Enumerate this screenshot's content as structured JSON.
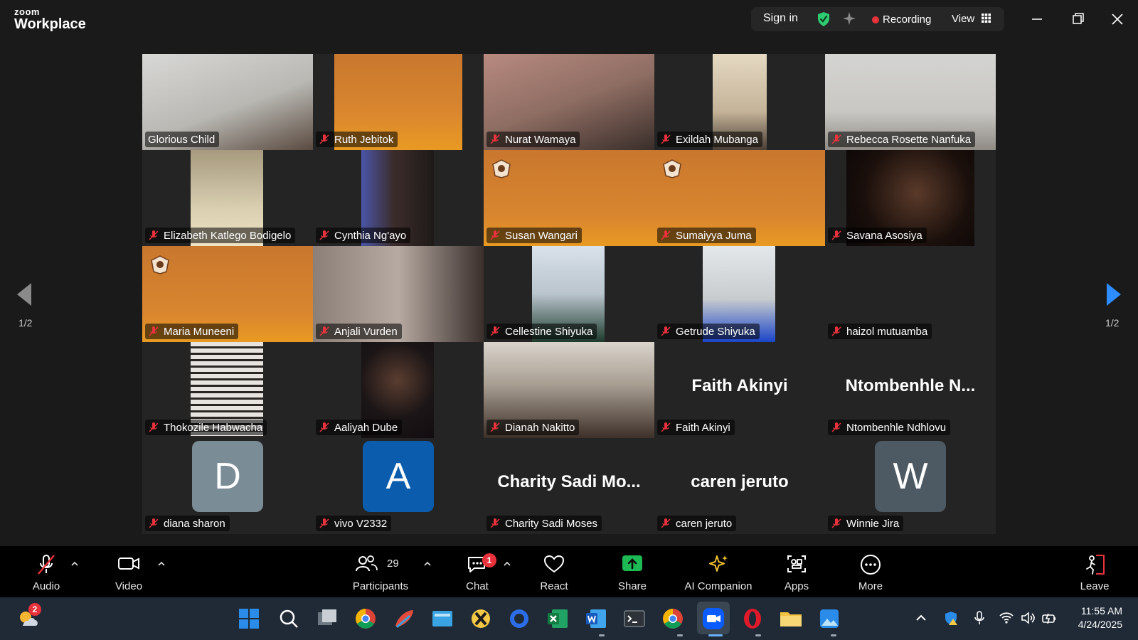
{
  "app": {
    "brand_small": "zoom",
    "brand_large": "Workplace"
  },
  "topbar": {
    "signin": "Sign in",
    "recording": "Recording",
    "view": "View"
  },
  "pagination": {
    "left": "1/2",
    "right": "1/2"
  },
  "tiles": [
    {
      "name": "Glorious Child",
      "muted": false,
      "active": true
    },
    {
      "name": "Ruth Jebitok",
      "muted": true
    },
    {
      "name": "Nurat Wamaya",
      "muted": true
    },
    {
      "name": "Exildah Mubanga",
      "muted": true
    },
    {
      "name": "Rebecca Rosette Nanfuka",
      "muted": true
    },
    {
      "name": "Elizabeth Katlego Bodigelo",
      "muted": true
    },
    {
      "name": "Cynthia Ng'ayo",
      "muted": true
    },
    {
      "name": "Susan Wangari",
      "muted": true
    },
    {
      "name": "Sumaiyya Juma",
      "muted": true
    },
    {
      "name": "Savana Asosiya",
      "muted": true
    },
    {
      "name": "Maria Muneeni",
      "muted": true
    },
    {
      "name": "Anjali Vurden",
      "muted": true
    },
    {
      "name": "Cellestine Shiyuka",
      "muted": true
    },
    {
      "name": "Getrude Shiyuka",
      "muted": true
    },
    {
      "name": "haizol mutuamba",
      "muted": true
    },
    {
      "name": "Thokozile Habwacha",
      "muted": true
    },
    {
      "name": "Aaliyah Dube",
      "muted": true
    },
    {
      "name": "Dianah Nakitto",
      "muted": true
    },
    {
      "name": "Faith Akinyi",
      "muted": true,
      "display": "Faith Akinyi"
    },
    {
      "name": "Ntombenhle Ndhlovu",
      "muted": true,
      "display": "Ntombenhle  N..."
    },
    {
      "name": "diana sharon",
      "muted": true,
      "initial": "D",
      "initial_color": "#7a8c96"
    },
    {
      "name": "vivo V2332",
      "muted": true,
      "initial": "A",
      "initial_color": "#0b5cad"
    },
    {
      "name": "Charity Sadi Moses",
      "muted": true,
      "display": "Charity  Sadi  Mo..."
    },
    {
      "name": "caren jeruto",
      "muted": true,
      "display": "caren jeruto"
    },
    {
      "name": "Winnie Jira",
      "muted": true,
      "initial": "W",
      "initial_color": "#4d5a63"
    }
  ],
  "toolbar": {
    "audio": "Audio",
    "video": "Video",
    "participants": "Participants",
    "participants_count": "29",
    "chat": "Chat",
    "chat_badge": "1",
    "react": "React",
    "share": "Share",
    "ai_companion": "AI Companion",
    "apps": "Apps",
    "more": "More",
    "leave": "Leave"
  },
  "taskbar": {
    "weather_badge": "2",
    "time": "11:55 AM",
    "date": "4/24/2025"
  },
  "colors": {
    "accent_green": "#2ecc71",
    "record_red": "#e8323c",
    "zoom_blue": "#0b5cff",
    "share_green": "#1db954"
  }
}
